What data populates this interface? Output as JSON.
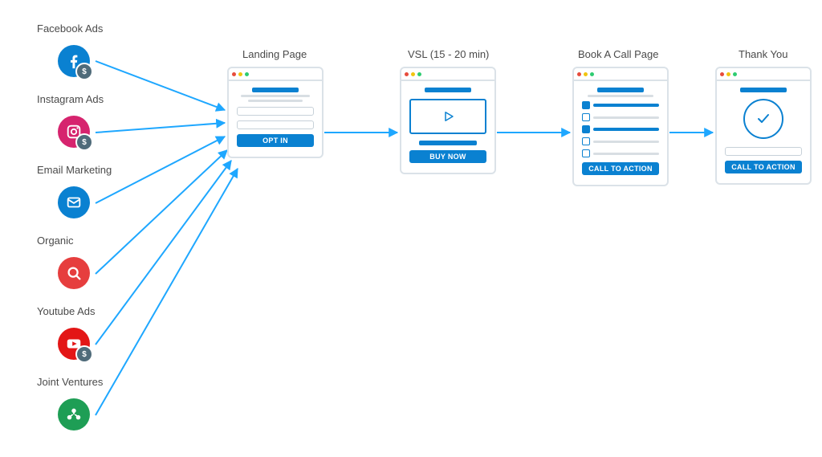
{
  "traffic_sources": [
    {
      "label": "Facebook Ads",
      "id": "facebook",
      "color": "#0a81d1",
      "has_dollar": true
    },
    {
      "label": "Instagram Ads",
      "id": "instagram",
      "color": "#d6246e",
      "has_dollar": true
    },
    {
      "label": "Email Marketing",
      "id": "email",
      "color": "#0a81d1",
      "has_dollar": false
    },
    {
      "label": "Organic",
      "id": "organic",
      "color": "#e63e3e",
      "has_dollar": false
    },
    {
      "label": "Youtube Ads",
      "id": "youtube",
      "color": "#e31616",
      "has_dollar": true
    },
    {
      "label": "Joint Ventures",
      "id": "jv",
      "color": "#1e9e55",
      "has_dollar": false
    }
  ],
  "pages": {
    "landing": {
      "title": "Landing Page",
      "button": "OPT IN"
    },
    "vsl": {
      "title": "VSL (15 - 20 min)",
      "button": "BUY NOW"
    },
    "book_call": {
      "title": "Book A Call Page",
      "button": "CALL TO ACTION"
    },
    "thank_you": {
      "title": "Thank You",
      "button": "CALL TO ACTION"
    }
  },
  "dollar_glyph": "$"
}
